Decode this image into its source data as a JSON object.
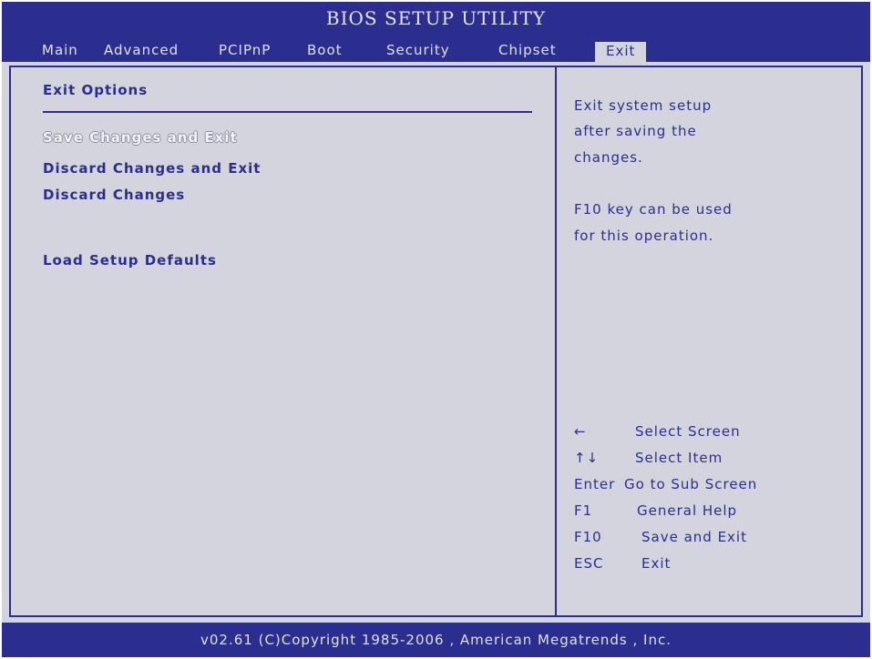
{
  "header": {
    "title": "BIOS SETUP UTILITY",
    "tabs": [
      "Main",
      "Advanced",
      "PCIPnP",
      "Boot",
      "Security",
      "Chipset",
      "Exit"
    ],
    "active_tab": "Exit"
  },
  "left_panel": {
    "section_title": "Exit Options",
    "options": [
      {
        "label": "Save Changes and Exit",
        "selected": true
      },
      {
        "label": "Discard Changes and Exit",
        "selected": false
      },
      {
        "label": "Discard Changes",
        "selected": false
      },
      {
        "label": "Load Setup Defaults",
        "selected": false
      }
    ]
  },
  "right_panel": {
    "help_lines": [
      "Exit system setup",
      "after saving the",
      "changes.",
      "F10 key can be used",
      "for this operation."
    ],
    "keys": [
      {
        "key": "←",
        "action": "Select Screen"
      },
      {
        "key": "↑↓",
        "action": "Select Item"
      },
      {
        "key": "Enter",
        "action": "Go to Sub Screen"
      },
      {
        "key": "F1",
        "action": "General Help"
      },
      {
        "key": "F10",
        "action": "Save and Exit"
      },
      {
        "key": "ESC",
        "action": "Exit"
      }
    ]
  },
  "footer": {
    "text": "v02.61  (C)Copyright 1985-2006 , American Megatrends , Inc."
  },
  "colors": {
    "accent": "#2b2e8f",
    "background": "#d4d4de"
  }
}
